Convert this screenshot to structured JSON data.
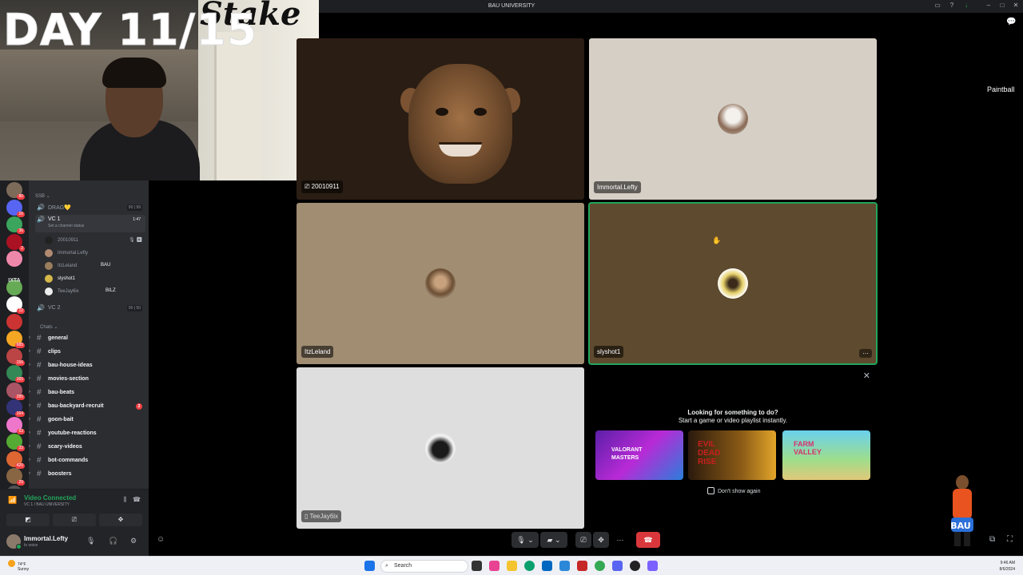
{
  "window": {
    "title": "BAU UNIVERSITY"
  },
  "overlay": {
    "day_text": "DAY 11/15"
  },
  "servers": [
    {
      "badge": "80"
    },
    {
      "badge": "16"
    },
    {
      "badge": "36"
    },
    {
      "badge": "2"
    },
    {
      "badge": ""
    },
    {
      "badge": ""
    },
    {
      "badge": "12"
    },
    {
      "badge": ""
    },
    {
      "badge": "685"
    },
    {
      "badge": "156"
    },
    {
      "badge": "165"
    },
    {
      "badge": "285"
    },
    {
      "badge": "164"
    },
    {
      "badge": "63"
    },
    {
      "badge": "33"
    },
    {
      "badge": "420"
    },
    {
      "badge": "29"
    },
    {
      "badge": "NEW"
    }
  ],
  "server_text": "IXTA",
  "channels": {
    "category_ssb": "SSB",
    "voice": [
      {
        "name": "DRAG💛",
        "count": "00 | 99"
      },
      {
        "name": "VC 1",
        "time": "1:47",
        "status": "Set a channel status"
      },
      {
        "name": "VC 2",
        "count": "00 | 50"
      }
    ],
    "members": [
      {
        "name": "20010911"
      },
      {
        "name": "Immortal.Lefty"
      },
      {
        "name": "ItzLeland",
        "tag": "BAU"
      },
      {
        "name": "slyshot1"
      },
      {
        "name": "TeeJay6ix",
        "tag": "BILZ"
      }
    ],
    "category_chats": "Chats",
    "text": [
      {
        "name": "general"
      },
      {
        "name": "clips"
      },
      {
        "name": "bau-house-ideas"
      },
      {
        "name": "movies-section"
      },
      {
        "name": "bau-beats"
      },
      {
        "name": "bau-backyard-recruit",
        "ping": "2"
      },
      {
        "name": "goon-bait"
      },
      {
        "name": "youtube-reactions"
      },
      {
        "name": "scary-videos"
      },
      {
        "name": "bot-commands"
      },
      {
        "name": "boosters"
      }
    ]
  },
  "voice_panel": {
    "title": "Video Connected",
    "subtitle": "VC 1 / BAU UNIVERSITY"
  },
  "user_panel": {
    "username": "Immortal.Lefty",
    "status": "In voice"
  },
  "tiles": [
    {
      "label": "20010911"
    },
    {
      "label": "Immortal.Lefty"
    },
    {
      "label": "ItzLeland"
    },
    {
      "label": "slyshot1"
    },
    {
      "label": "TeeJay6ix"
    }
  ],
  "activity": {
    "heading": "Looking for something to do?",
    "subheading": "Start a game or video playlist instantly.",
    "cards": [
      {
        "title": "VALORANT MASTERS"
      },
      {
        "title": "EVIL DEAD RISE"
      },
      {
        "title": "FARM VALLEY"
      }
    ],
    "dont_show": "Don't show again"
  },
  "right": {
    "paintball": "Paintball"
  },
  "taskbar": {
    "weather_temp": "74°F",
    "weather_desc": "Sunny",
    "search": "Search",
    "time": "9:46 AM",
    "date": "8/6/2024"
  },
  "colors": {
    "discord_bg": "#313338",
    "sidebar_bg": "#2b2d31",
    "rail_bg": "#1e1f22",
    "green": "#23a55a",
    "red": "#da373c"
  }
}
